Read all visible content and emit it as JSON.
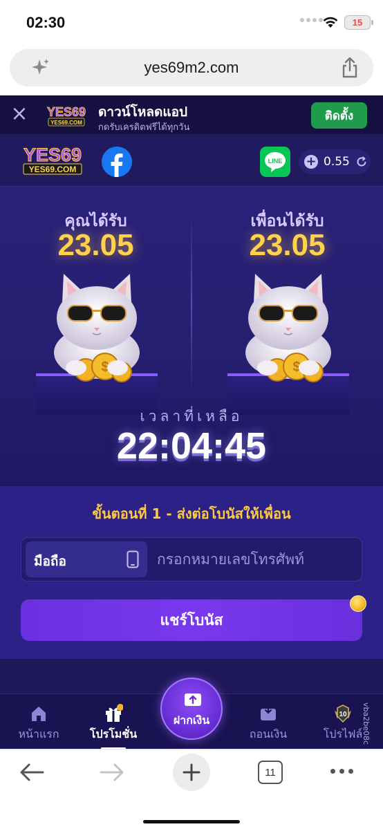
{
  "status_bar": {
    "time": "02:30",
    "battery": "15"
  },
  "browser": {
    "url": "yes69m2.com",
    "tab_count": "11"
  },
  "app_banner": {
    "logo_text": "YES69",
    "logo_sub": "YES69.COM",
    "title": "ดาวน์โหลดแอป",
    "subtitle": "กดรับเครดิตฟรีได้ทุกวัน",
    "install_label": "ติดตั้ง"
  },
  "header": {
    "logo_text": "YES69",
    "logo_sub": "YES69.COM",
    "line_label": "LINE",
    "balance": "0.55"
  },
  "rewards": {
    "you_label": "คุณได้รับ",
    "you_value": "23.05",
    "friend_label": "เพื่อนได้รับ",
    "friend_value": "23.05"
  },
  "timer": {
    "label": "เวลาที่เหลือ",
    "value": "22:04:45"
  },
  "step": {
    "title": "ขั้นตอนที่ 1 - ส่งต่อโบนัสให้เพื่อน",
    "phone_tag": "มือถือ",
    "phone_placeholder": "กรอกหมายเลขโทรศัพท์",
    "share_label": "แชร์โบนัส"
  },
  "tab_bar": {
    "items": [
      {
        "label": "หน้าแรก",
        "icon": "home-icon"
      },
      {
        "label": "โปรโมชั่น",
        "icon": "gift-icon"
      },
      {
        "label": "ฝากเงิน",
        "icon": "deposit-icon"
      },
      {
        "label": "ถอนเงิน",
        "icon": "wallet-icon"
      },
      {
        "label": "โปรไฟล์",
        "icon": "level-badge-icon"
      }
    ],
    "level_number": "10",
    "active_index": 1
  },
  "side_id": "vba2be08c",
  "colors": {
    "page_bg": "#1d1650",
    "accent_gold": "#ffd24a",
    "accent_purple": "#7a38ee",
    "install_green": "#1f9b4c"
  }
}
